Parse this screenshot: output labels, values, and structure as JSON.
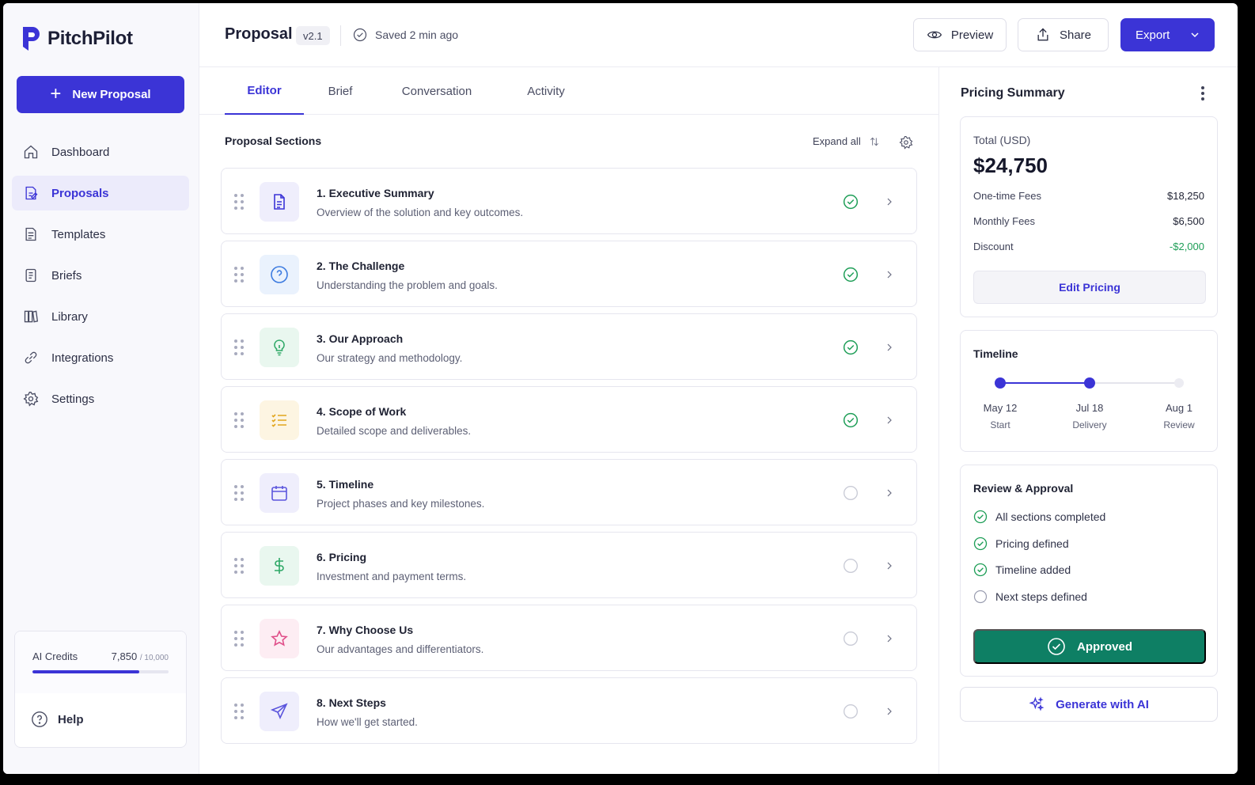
{
  "app": {
    "name": "PitchPilot",
    "brand_color": "#3b34d6"
  },
  "sidebar": {
    "new_button_label": "New Proposal",
    "items": [
      {
        "label": "Dashboard",
        "icon": "home-icon",
        "active": false
      },
      {
        "label": "Proposals",
        "icon": "proposal-doc-icon",
        "active": true
      },
      {
        "label": "Templates",
        "icon": "template-icon",
        "active": false
      },
      {
        "label": "Briefs",
        "icon": "brief-icon",
        "active": false
      },
      {
        "label": "Library",
        "icon": "library-icon",
        "active": false
      },
      {
        "label": "Integrations",
        "icon": "link-icon",
        "active": false
      },
      {
        "label": "Settings",
        "icon": "gear-icon",
        "active": false
      }
    ],
    "credits": {
      "label": "AI Credits",
      "used": "7,850",
      "max": "/ 10,000",
      "fraction": 0.785
    },
    "help_label": "Help"
  },
  "header": {
    "title": "Proposal",
    "version": "v2.1",
    "saved_status": "Saved 2 min ago",
    "preview_label": "Preview",
    "share_label": "Share",
    "export_label": "Export"
  },
  "tabs": [
    {
      "label": "Editor",
      "active": true
    },
    {
      "label": "Brief",
      "active": false
    },
    {
      "label": "Conversation",
      "active": false
    },
    {
      "label": "Activity",
      "active": false
    }
  ],
  "sections": {
    "heading": "Proposal Sections",
    "expand_label": "Expand all",
    "items": [
      {
        "title": "1. Executive Summary",
        "desc": "Overview of the solution and key outcomes.",
        "icon": "document-icon",
        "complete": true,
        "color": "#3b34d6",
        "bg": "#efeefc"
      },
      {
        "title": "2. The Challenge",
        "desc": "Understanding the problem and goals.",
        "icon": "question-icon",
        "complete": true,
        "color": "#3d7be0",
        "bg": "#eaf2fd"
      },
      {
        "title": "3. Our Approach",
        "desc": "Our strategy and methodology.",
        "icon": "lightbulb-icon",
        "complete": true,
        "color": "#2ea866",
        "bg": "#e9f7ef"
      },
      {
        "title": "4. Scope of Work",
        "desc": "Detailed scope and deliverables.",
        "icon": "checklist-icon",
        "complete": true,
        "color": "#e2a61c",
        "bg": "#fdf5e2"
      },
      {
        "title": "5. Timeline",
        "desc": "Project phases and key milestones.",
        "icon": "calendar-icon",
        "complete": false,
        "color": "#5b55dd",
        "bg": "#efeefc"
      },
      {
        "title": "6. Pricing",
        "desc": "Investment and payment terms.",
        "icon": "dollar-icon",
        "complete": false,
        "color": "#2ea866",
        "bg": "#e9f7ef"
      },
      {
        "title": "7. Why Choose Us",
        "desc": "Our advantages and differentiators.",
        "icon": "star-icon",
        "complete": false,
        "color": "#e0508a",
        "bg": "#fdedf3"
      },
      {
        "title": "8. Next Steps",
        "desc": "How we'll get started.",
        "icon": "send-icon",
        "complete": false,
        "color": "#5b55dd",
        "bg": "#efeefc"
      }
    ]
  },
  "pricing": {
    "title": "Pricing Summary",
    "total_label": "Total (USD)",
    "total_value": "$24,750",
    "rows": [
      {
        "label": "One-time Fees",
        "value": "$18,250",
        "negative": false
      },
      {
        "label": "Monthly Fees",
        "value": "$6,500",
        "negative": false
      },
      {
        "label": "Discount",
        "value": "-$2,000",
        "negative": true
      }
    ],
    "edit_label": "Edit Pricing"
  },
  "timeline": {
    "title": "Timeline",
    "milestones": [
      {
        "date": "May 12",
        "label": "Start",
        "reached": true
      },
      {
        "date": "Jul 18",
        "label": "Delivery",
        "reached": true
      },
      {
        "date": "Aug 1",
        "label": "Review",
        "reached": false
      }
    ]
  },
  "review": {
    "title": "Review & Approval",
    "items": [
      {
        "label": "All sections completed",
        "done": true
      },
      {
        "label": "Pricing defined",
        "done": true
      },
      {
        "label": "Timeline added",
        "done": true
      },
      {
        "label": "Next steps defined",
        "done": false
      }
    ],
    "approved_label": "Approved",
    "approved_color": "#0e7f64"
  },
  "generate_label": "Generate with AI",
  "status_colors": {
    "complete": "#1e9e57",
    "incomplete": "#c9cbd6"
  }
}
